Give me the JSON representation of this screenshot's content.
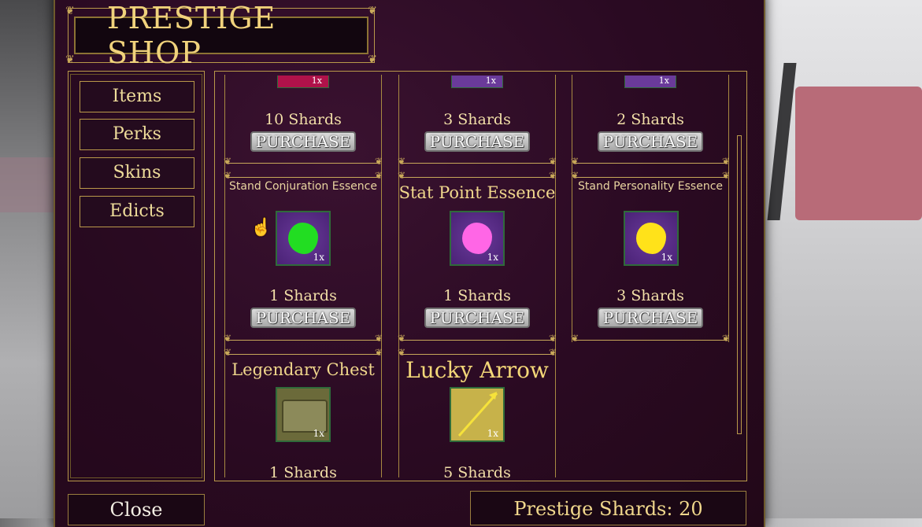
{
  "title": "PRESTIGE SHOP",
  "nav": [
    "Items",
    "Perks",
    "Skins",
    "Edicts"
  ],
  "top_row": [
    {
      "price": "10 Shards",
      "qty": "1x",
      "color": "#b0124a"
    },
    {
      "price": "3 Shards",
      "qty": "1x",
      "color": "#6a3a9a"
    },
    {
      "price": "2 Shards",
      "qty": "1x",
      "color": "#6a3a9a"
    }
  ],
  "mid_row": [
    {
      "name": "Stand Conjuration Essence",
      "price": "1 Shards",
      "qty": "1x",
      "blob_color": "#22dd22"
    },
    {
      "name": "Stat Point Essence",
      "price": "1 Shards",
      "qty": "1x",
      "blob_color": "#ff66e6"
    },
    {
      "name": "Stand Personality Essence",
      "price": "3 Shards",
      "qty": "1x",
      "blob_color": "#ffe21a"
    }
  ],
  "bottom_row": [
    {
      "name": "Legendary Chest",
      "price": "1 Shards",
      "qty": "1x"
    },
    {
      "name": "Lucky Arrow",
      "price": "5 Shards",
      "qty": "1x"
    }
  ],
  "purchase_label": "PURCHASE",
  "close_label": "Close",
  "shards_label": "Prestige Shards: 20"
}
